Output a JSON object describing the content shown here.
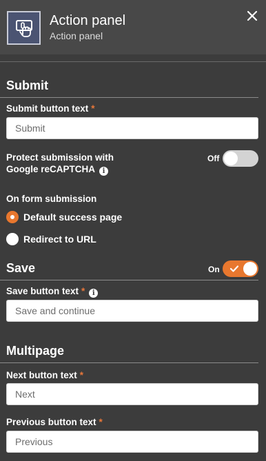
{
  "header": {
    "title": "Action panel",
    "subtitle": "Action panel",
    "icon": "touch-hand-icon",
    "close_icon": "close-icon"
  },
  "submit": {
    "section_title": "Submit",
    "button_text_label": "Submit button text",
    "required_mark": "*",
    "button_text_placeholder": "Submit",
    "captcha_label_line1": "Protect submission with",
    "captcha_label_line2": "Google reCAPTCHA",
    "captcha_toggle_label": "Off",
    "captcha_enabled": false,
    "on_submission_label": "On form submission",
    "options": [
      {
        "label": "Default success page",
        "selected": true
      },
      {
        "label": "Redirect to URL",
        "selected": false
      }
    ]
  },
  "save": {
    "section_title": "Save",
    "toggle_label": "On",
    "enabled": true,
    "button_text_label": "Save button text",
    "required_mark": "*",
    "button_text_placeholder": "Save and continue"
  },
  "multipage": {
    "section_title": "Multipage",
    "next_label": "Next button text",
    "next_required_mark": "*",
    "next_placeholder": "Next",
    "previous_label": "Previous button text",
    "previous_required_mark": "*",
    "previous_placeholder": "Previous"
  },
  "colors": {
    "background": "#3c3c3c",
    "header_background": "#484848",
    "accent": "#e8772e",
    "icon_tile": "#4b5472"
  }
}
